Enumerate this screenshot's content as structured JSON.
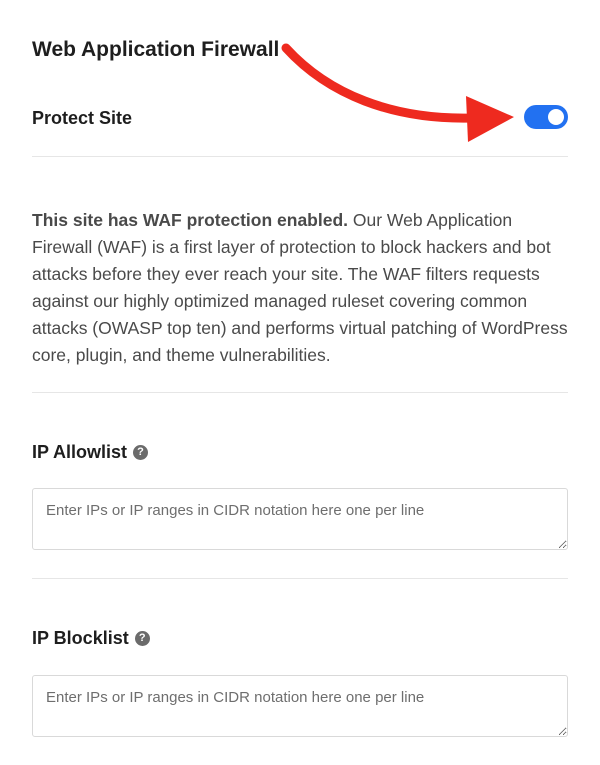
{
  "waf": {
    "title": "Web Application Firewall",
    "protect_label": "Protect Site",
    "protect_enabled": true,
    "desc_bold": "This site has WAF protection enabled.",
    "desc_rest": " Our Web Application Firewall (WAF) is a first layer of protection to block hackers and bot attacks before they ever reach your site. The WAF filters requests against our highly optimized managed ruleset covering common attacks (OWASP top ten) and performs virtual patching of WordPress core, plugin, and theme vulnerabilities."
  },
  "allowlist": {
    "label": "IP Allowlist",
    "help": "?",
    "placeholder": "Enter IPs or IP ranges in CIDR notation here one per line",
    "value": ""
  },
  "blocklist": {
    "label": "IP Blocklist",
    "help": "?",
    "placeholder": "Enter IPs or IP ranges in CIDR notation here one per line",
    "value": ""
  },
  "colors": {
    "toggle_on": "#2271f1",
    "arrow": "#ee2a1f"
  },
  "icons": {
    "help": "question-circle-icon",
    "annotation": "red-arrow-icon"
  }
}
